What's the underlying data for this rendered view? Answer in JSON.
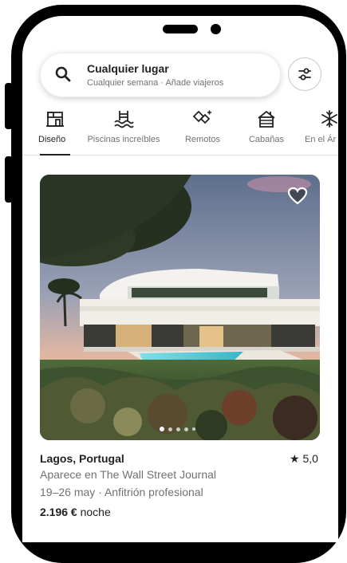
{
  "search": {
    "title": "Cualquier lugar",
    "subtitle": "Cualquier semana · Añade viajeros"
  },
  "categories": [
    {
      "label": "Diseño",
      "icon": "design-icon",
      "active": true
    },
    {
      "label": "Piscinas increíbles",
      "icon": "pool-icon",
      "active": false
    },
    {
      "label": "Remotos",
      "icon": "remote-icon",
      "active": false
    },
    {
      "label": "Cabañas",
      "icon": "cabin-icon",
      "active": false
    },
    {
      "label": "En el Ár",
      "icon": "snowflake-icon",
      "active": false
    }
  ],
  "listing": {
    "location": "Lagos, Portugal",
    "rating_star": "★",
    "rating": "5,0",
    "featured": "Aparece en The Wall Street Journal",
    "dates_host": "19–26 may · Anfitrión profesional",
    "price": "2.196 €",
    "price_unit": " noche",
    "photo_count": 5,
    "photo_index": 0
  },
  "colors": {
    "text": "#222222",
    "muted": "#717171",
    "border": "#e2e2e2"
  }
}
